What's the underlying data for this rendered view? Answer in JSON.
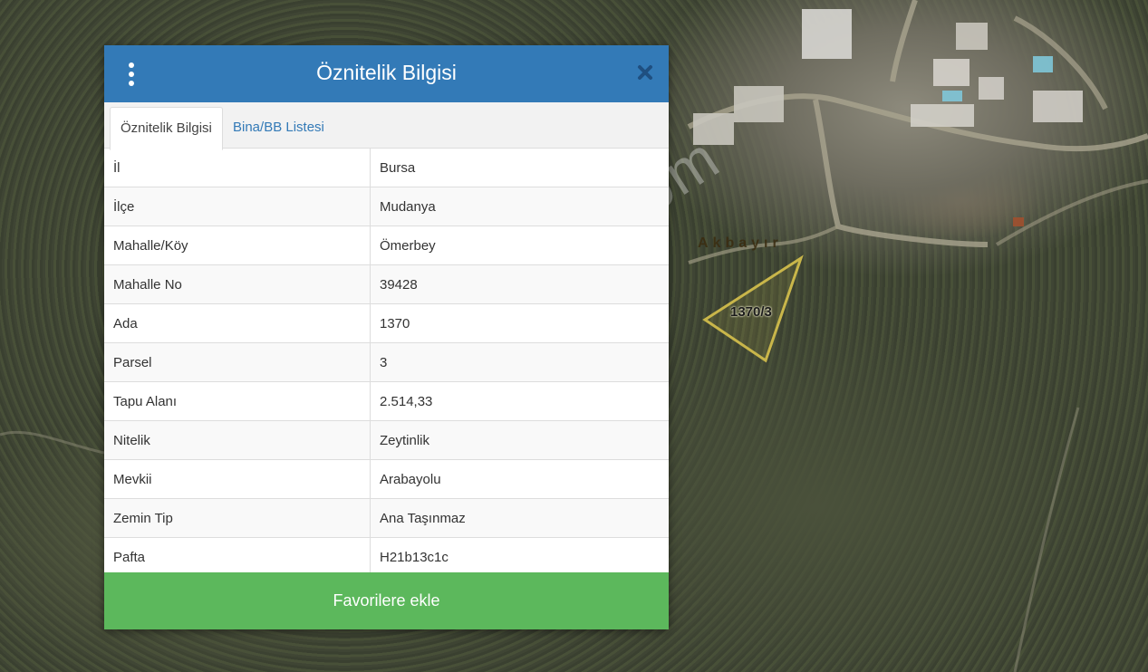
{
  "map": {
    "place_label": "Akbayır",
    "parcel_label": "1370/3",
    "watermark": "emlakjet.com"
  },
  "dialog": {
    "title": "Öznitelik Bilgisi",
    "tabs": [
      {
        "label": "Öznitelik Bilgisi",
        "active": true
      },
      {
        "label": "Bina/BB Listesi",
        "active": false
      }
    ],
    "rows": [
      {
        "key": "İl",
        "value": "Bursa"
      },
      {
        "key": "İlçe",
        "value": "Mudanya"
      },
      {
        "key": "Mahalle/Köy",
        "value": "Ömerbey"
      },
      {
        "key": "Mahalle No",
        "value": "39428"
      },
      {
        "key": "Ada",
        "value": "1370"
      },
      {
        "key": "Parsel",
        "value": "3"
      },
      {
        "key": "Tapu Alanı",
        "value": "2.514,33"
      },
      {
        "key": "Nitelik",
        "value": "Zeytinlik"
      },
      {
        "key": "Mevkii",
        "value": "Arabayolu"
      },
      {
        "key": "Zemin Tip",
        "value": "Ana Taşınmaz"
      },
      {
        "key": "Pafta",
        "value": "H21b13c1c"
      }
    ],
    "favorite_button": "Favorilere ekle"
  },
  "colors": {
    "header": "#337ab7",
    "button": "#5cb85c",
    "parcel_outline": "#c9b64a"
  },
  "icons": {
    "menu": "kebab-menu-icon",
    "close": "close-icon"
  }
}
